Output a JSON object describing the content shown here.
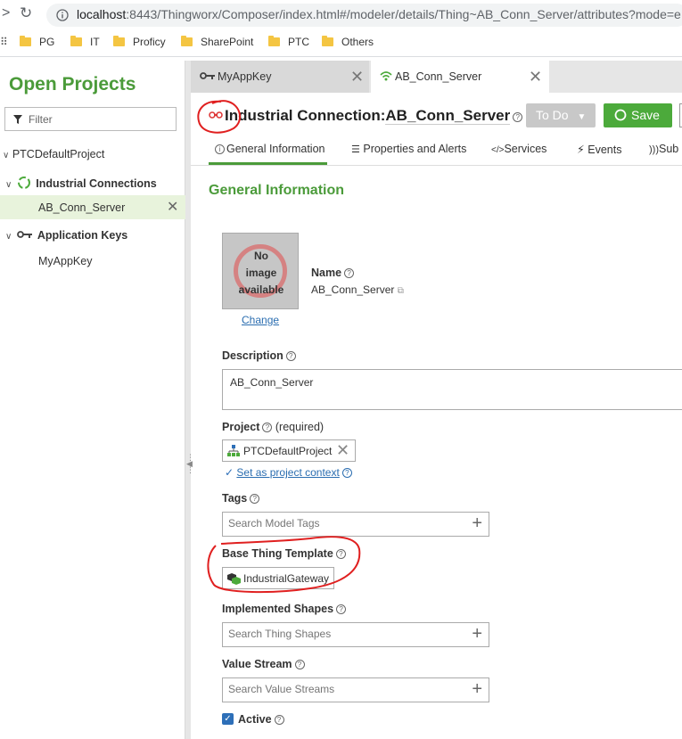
{
  "browser": {
    "url_prefix": "localhost",
    "url_rest": ":8443/Thingworx/Composer/index.html#/modeler/details/Thing~AB_Conn_Server/attributes?mode=e",
    "bookmarks": [
      "PG",
      "IT",
      "Proficy",
      "SharePoint",
      "PTC",
      "Others"
    ]
  },
  "sidebar": {
    "title": "Open Projects",
    "filter_placeholder": "Filter",
    "project": "PTCDefaultProject",
    "group1": "Industrial Connections",
    "item1": "AB_Conn_Server",
    "group2": "Application Keys",
    "item2": "MyAppKey"
  },
  "tabs": [
    {
      "label": "MyAppKey"
    },
    {
      "label": "AB_Conn_Server"
    }
  ],
  "header": {
    "type_label": "Industrial Connection:",
    "thing_name": "AB_Conn_Server",
    "todo_label": "To Do",
    "save_label": "Save"
  },
  "subtabs": [
    "General Information",
    "Properties and Alerts",
    "Services",
    "Events",
    "Sub"
  ],
  "section": {
    "title": "General Information"
  },
  "image": {
    "no_image_text": "No\nimage\navailable",
    "change_label": "Change"
  },
  "fields": {
    "name_label": "Name",
    "name_value": "AB_Conn_Server",
    "description_label": "Description",
    "description_value": "AB_Conn_Server",
    "project_label": "Project",
    "project_required": "(required)",
    "project_value": "PTCDefaultProject",
    "project_context_link": "Set as project context",
    "tags_label": "Tags",
    "tags_placeholder": "Search Model Tags",
    "base_template_label": "Base Thing Template",
    "base_template_value": "IndustrialGateway",
    "shapes_label": "Implemented Shapes",
    "shapes_placeholder": "Search Thing Shapes",
    "value_stream_label": "Value Stream",
    "value_stream_placeholder": "Search Value Streams",
    "active_label": "Active"
  }
}
